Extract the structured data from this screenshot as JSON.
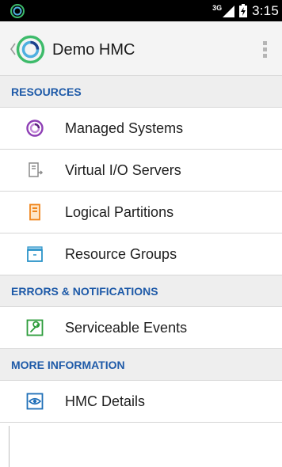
{
  "status_bar": {
    "network_type": "3G",
    "time": "3:15"
  },
  "action_bar": {
    "title": "Demo HMC"
  },
  "sections": [
    {
      "header": "RESOURCES",
      "items": [
        {
          "label": "Managed Systems",
          "icon": "managed-systems-icon"
        },
        {
          "label": "Virtual I/O Servers",
          "icon": "virtual-io-servers-icon"
        },
        {
          "label": "Logical Partitions",
          "icon": "logical-partitions-icon"
        },
        {
          "label": "Resource Groups",
          "icon": "resource-groups-icon"
        }
      ]
    },
    {
      "header": "ERRORS & NOTIFICATIONS",
      "items": [
        {
          "label": "Serviceable Events",
          "icon": "wrench-icon"
        }
      ]
    },
    {
      "header": "MORE INFORMATION",
      "items": [
        {
          "label": "HMC Details",
          "icon": "eye-icon"
        }
      ]
    }
  ],
  "colors": {
    "section_header_text": "#1e5aa8",
    "managed_systems": "#8e3fb5",
    "virtual_io": "#8a8a8a",
    "logical_partitions": "#f0861e",
    "resource_groups": "#2b93c9",
    "serviceable_events": "#2c9c3a",
    "hmc_details": "#1f6fb8"
  }
}
